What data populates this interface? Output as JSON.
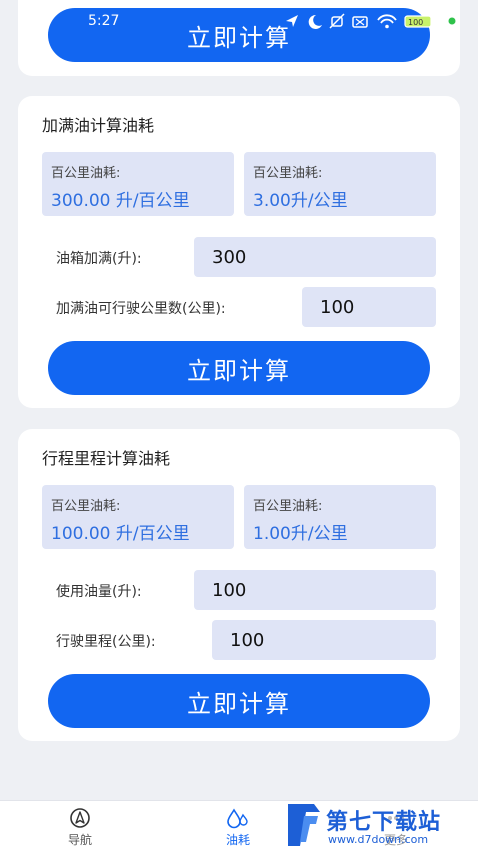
{
  "status_bar": {
    "time": "5:27",
    "battery": "100"
  },
  "top_card": {
    "calc_button": "立即计算"
  },
  "full_tank_card": {
    "title": "加满油计算油耗",
    "result_left": {
      "label": "百公里油耗:",
      "value": "300.00 升/百公里"
    },
    "result_right": {
      "label": "百公里油耗:",
      "value": "3.00升/公里"
    },
    "field_fuel": {
      "label": "油箱加满(升):",
      "value": "300"
    },
    "field_distance": {
      "label": "加满油可行驶公里数(公里):",
      "value": "100"
    },
    "calc_button": "立即计算"
  },
  "trip_card": {
    "title": "行程里程计算油耗",
    "result_left": {
      "label": "百公里油耗:",
      "value": "100.00 升/百公里"
    },
    "result_right": {
      "label": "百公里油耗:",
      "value": "1.00升/公里"
    },
    "field_fuel": {
      "label": "使用油量(升):",
      "value": "100"
    },
    "field_distance": {
      "label": "行驶里程(公里):",
      "value": "100"
    },
    "calc_button": "立即计算"
  },
  "bottom_nav": {
    "items": [
      {
        "label": "导航",
        "icon": "navigation-icon",
        "active": false
      },
      {
        "label": "油耗",
        "icon": "fuel-drop-icon",
        "active": true
      },
      {
        "label": "更多",
        "icon": "more-icon",
        "active": false
      }
    ]
  },
  "watermark": {
    "brand": "第七下载站",
    "url": "www.d7down.com"
  },
  "colors": {
    "primary": "#1266f1",
    "result_text": "#2f6fe0",
    "input_bg": "#dfe4f6",
    "page_bg": "#eef0f4"
  }
}
